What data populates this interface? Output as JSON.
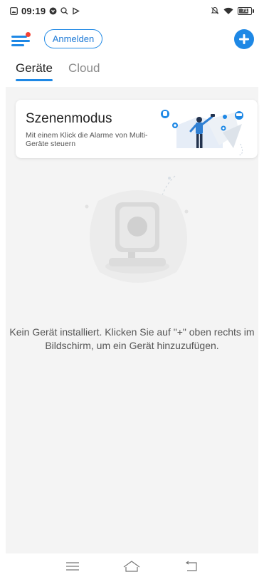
{
  "status_bar": {
    "time": "09:19",
    "battery": "71"
  },
  "header": {
    "login_label": "Anmelden"
  },
  "tabs": [
    {
      "label": "Geräte",
      "active": true
    },
    {
      "label": "Cloud",
      "active": false
    }
  ],
  "scene_card": {
    "title": "Szenenmodus",
    "description": "Mit einem Klick die Alarme von Multi-Geräte steuern"
  },
  "empty_state": {
    "message": "Kein Gerät installiert. Klicken Sie auf \"+\" oben rechts im Bildschirm, um ein Gerät hinzuzufügen."
  },
  "icons": {
    "menu": "menu-icon",
    "add": "plus-icon",
    "nav_menu": "menu-lines-icon",
    "nav_home": "home-icon",
    "nav_back": "back-icon"
  },
  "colors": {
    "accent": "#1e88e5",
    "notification_dot": "#f44336",
    "background_panel": "#f4f4f4"
  }
}
